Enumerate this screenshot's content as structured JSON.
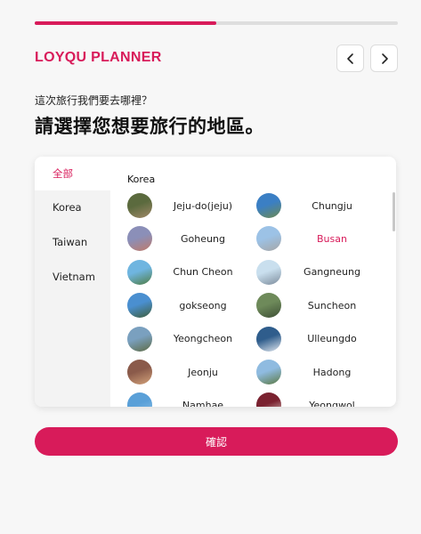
{
  "progress": {
    "fraction": 0.5
  },
  "header": {
    "brand": "LOYQU PLANNER",
    "prev_icon": "chevron-left-icon",
    "next_icon": "chevron-right-icon"
  },
  "prompt": {
    "question": "這次旅行我們要去哪裡？",
    "headline": "請選擇您想要旅行的地區。"
  },
  "sidebar": {
    "items": [
      {
        "label": "全部",
        "active": true
      },
      {
        "label": "Korea",
        "active": false
      },
      {
        "label": "Taiwan",
        "active": false
      },
      {
        "label": "Vietnam",
        "active": false
      }
    ]
  },
  "list": {
    "group_title": "Korea",
    "regions": [
      {
        "name": "Jeju-do(jeju)",
        "selected": false,
        "colors": [
          "#5b6a3e",
          "#a08868"
        ]
      },
      {
        "name": "Chungju",
        "selected": false,
        "colors": [
          "#3b7fc4",
          "#6d8a52"
        ]
      },
      {
        "name": "Goheung",
        "selected": false,
        "colors": [
          "#8b8fb8",
          "#c07a6a"
        ]
      },
      {
        "name": "Busan",
        "selected": true,
        "colors": [
          "#9cc2e6",
          "#a6a6a6"
        ]
      },
      {
        "name": "Chun Cheon",
        "selected": false,
        "colors": [
          "#6fb5e0",
          "#4f7d44"
        ]
      },
      {
        "name": "Gangneung",
        "selected": false,
        "colors": [
          "#c9dfee",
          "#7d8c9c"
        ]
      },
      {
        "name": "gokseong",
        "selected": false,
        "colors": [
          "#4a8fd0",
          "#3f5e3a"
        ]
      },
      {
        "name": "Suncheon",
        "selected": false,
        "colors": [
          "#6e8a5a",
          "#3d4f35"
        ]
      },
      {
        "name": "Yeongcheon",
        "selected": false,
        "colors": [
          "#7aa0bf",
          "#5e6b45"
        ]
      },
      {
        "name": "Ulleungdo",
        "selected": false,
        "colors": [
          "#2f5d8c",
          "#e0e6ee"
        ]
      },
      {
        "name": "Jeonju",
        "selected": false,
        "colors": [
          "#8a5a4a",
          "#d3a27a"
        ]
      },
      {
        "name": "Hadong",
        "selected": false,
        "colors": [
          "#8fbbe0",
          "#5c7a44"
        ]
      },
      {
        "name": "Namhae",
        "selected": false,
        "colors": [
          "#5aa0d8",
          "#8cc1e8"
        ]
      },
      {
        "name": "Yeongwol",
        "selected": false,
        "colors": [
          "#7a2230",
          "#e4d8d0"
        ]
      }
    ]
  },
  "confirm": {
    "label": "確認"
  }
}
